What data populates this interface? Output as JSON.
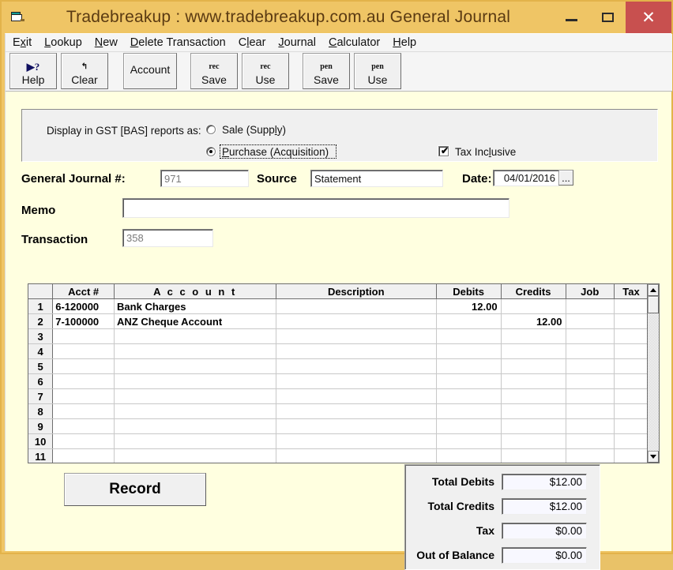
{
  "window": {
    "title": "Tradebreakup :  www.tradebreakup.com.au   General Journal",
    "icon": "journal-document-icon",
    "minimize_label": "–",
    "maximize_label": "□",
    "close_label": "✕",
    "titlebar_color": "#efc565",
    "close_color": "#c8504f",
    "body_color": "#ffffe0"
  },
  "menu": {
    "items": [
      {
        "label": "Exit",
        "pre": "E",
        "accel": "x",
        "post": "it"
      },
      {
        "label": "Lookup",
        "pre": "",
        "accel": "L",
        "post": "ookup"
      },
      {
        "label": "New",
        "pre": "",
        "accel": "N",
        "post": "ew"
      },
      {
        "label": "Delete Transaction",
        "pre": "",
        "accel": "D",
        "post": "elete Transaction"
      },
      {
        "label": "Clear",
        "pre": "C",
        "accel": "l",
        "post": "ear"
      },
      {
        "label": "Journal",
        "pre": "",
        "accel": "J",
        "post": "ournal"
      },
      {
        "label": "Calculator",
        "pre": "",
        "accel": "C",
        "post": "alculator"
      },
      {
        "label": "Help",
        "pre": "",
        "accel": "H",
        "post": "elp"
      }
    ]
  },
  "toolbar": {
    "help": {
      "label": "Help",
      "glyph": "help-cursor-icon",
      "glyph_text": "▸?"
    },
    "clear": {
      "label": "Clear",
      "glyph": "undo-arrow-icon",
      "glyph_text": "↶"
    },
    "account": {
      "label": "Account"
    },
    "rec_save": {
      "label": "Save",
      "glyph": "recurring-icon",
      "glyph_text": "rec"
    },
    "rec_use": {
      "label": "Use",
      "glyph": "recurring-icon",
      "glyph_text": "rec"
    },
    "pen_save": {
      "label": "Save",
      "glyph": "pending-icon",
      "glyph_text": "pen"
    },
    "pen_use": {
      "label": "Use",
      "glyph": "pending-icon",
      "glyph_text": "pen"
    }
  },
  "gst_panel": {
    "prompt": "Display in GST [BAS] reports as:",
    "option_sale": {
      "label": "Sale (Supply)",
      "selected": false
    },
    "option_purchase": {
      "pre": "",
      "accel": "P",
      "post": "urchase (Acquisition)",
      "label": "Purchase (Acquisition)",
      "selected": true,
      "focused": true
    },
    "tax_inclusive": {
      "pre": "Tax Inc",
      "accel": "l",
      "post": "usive",
      "label": "Tax Inclusive",
      "checked": true,
      "tick": "✔"
    }
  },
  "form": {
    "journal_label": "General Journal #:",
    "journal_value": "971",
    "journal_disabled": true,
    "source_label": "Source",
    "source_value": "Statement",
    "date_label": "Date:",
    "date_value": "04/01/2016",
    "date_picker_label": "...",
    "memo_label": "Memo",
    "memo_value": "",
    "memo_placeholder": "",
    "transaction_label": "Transaction",
    "transaction_value": "358",
    "transaction_disabled": true
  },
  "grid": {
    "columns": [
      "",
      "Acct #",
      "A c c o u n t",
      "Description",
      "Debits",
      "Credits",
      "Job",
      "Tax"
    ],
    "rows": [
      {
        "no": "1",
        "acct": "6-120000",
        "account": "Bank Charges",
        "description": "",
        "debits": "12.00",
        "credits": "",
        "job": "",
        "tax": ""
      },
      {
        "no": "2",
        "acct": "7-100000",
        "account": "ANZ Cheque Account",
        "description": "",
        "debits": "",
        "credits": "12.00",
        "job": "",
        "tax": ""
      },
      {
        "no": "3",
        "acct": "",
        "account": "",
        "description": "",
        "debits": "",
        "credits": "",
        "job": "",
        "tax": ""
      },
      {
        "no": "4",
        "acct": "",
        "account": "",
        "description": "",
        "debits": "",
        "credits": "",
        "job": "",
        "tax": ""
      },
      {
        "no": "5",
        "acct": "",
        "account": "",
        "description": "",
        "debits": "",
        "credits": "",
        "job": "",
        "tax": ""
      },
      {
        "no": "6",
        "acct": "",
        "account": "",
        "description": "",
        "debits": "",
        "credits": "",
        "job": "",
        "tax": ""
      },
      {
        "no": "7",
        "acct": "",
        "account": "",
        "description": "",
        "debits": "",
        "credits": "",
        "job": "",
        "tax": ""
      },
      {
        "no": "8",
        "acct": "",
        "account": "",
        "description": "",
        "debits": "",
        "credits": "",
        "job": "",
        "tax": ""
      },
      {
        "no": "9",
        "acct": "",
        "account": "",
        "description": "",
        "debits": "",
        "credits": "",
        "job": "",
        "tax": ""
      },
      {
        "no": "10",
        "acct": "",
        "account": "",
        "description": "",
        "debits": "",
        "credits": "",
        "job": "",
        "tax": ""
      },
      {
        "no": "11",
        "acct": "",
        "account": "",
        "description": "",
        "debits": "",
        "credits": "",
        "job": "",
        "tax": ""
      }
    ],
    "scroll_up_label": "▲",
    "scroll_down_label": "▼"
  },
  "actions": {
    "record_label": "Record"
  },
  "totals": {
    "rows": [
      {
        "label": "Total Debits",
        "value": "$12.00"
      },
      {
        "label": "Total Credits",
        "value": "$12.00"
      },
      {
        "label": "Tax",
        "value": "$0.00"
      },
      {
        "label": "Out of Balance",
        "value": "$0.00"
      }
    ]
  }
}
